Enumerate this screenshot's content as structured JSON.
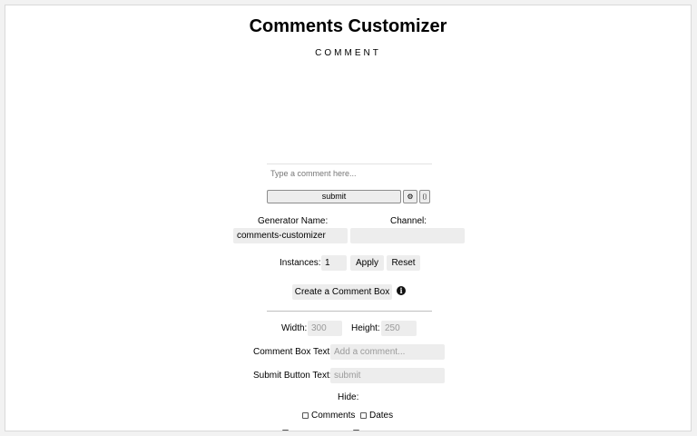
{
  "header": {
    "title": "Comments Customizer",
    "subtitle": "COMMENT"
  },
  "comment_box": {
    "placeholder": "Type a comment here...",
    "submit_label": "submit",
    "gear_glyph": "⚙",
    "extra_glyph": "⌷"
  },
  "generator": {
    "name_label": "Generator Name:",
    "name_value": "comments-customizer",
    "channel_label": "Channel:",
    "channel_value": ""
  },
  "instances": {
    "label": "Instances:",
    "value": "1",
    "apply_label": "Apply",
    "reset_label": "Reset"
  },
  "create": {
    "label": "Create a Comment Box",
    "info_glyph": "i"
  },
  "settings": {
    "width_label": "Width:",
    "width_placeholder": "300",
    "height_label": "Height:",
    "height_placeholder": "250",
    "box_text_label": "Comment Box Text:",
    "box_text_placeholder": "Add a comment...",
    "submit_text_label": "Submit Button Text:",
    "submit_text_placeholder": "submit",
    "hide_label": "Hide:",
    "hide_options": [
      {
        "label": "Comments",
        "checked": false
      },
      {
        "label": "Dates",
        "checked": false
      }
    ]
  },
  "icons": {
    "settings": "gear-icon",
    "info": "info-icon"
  }
}
